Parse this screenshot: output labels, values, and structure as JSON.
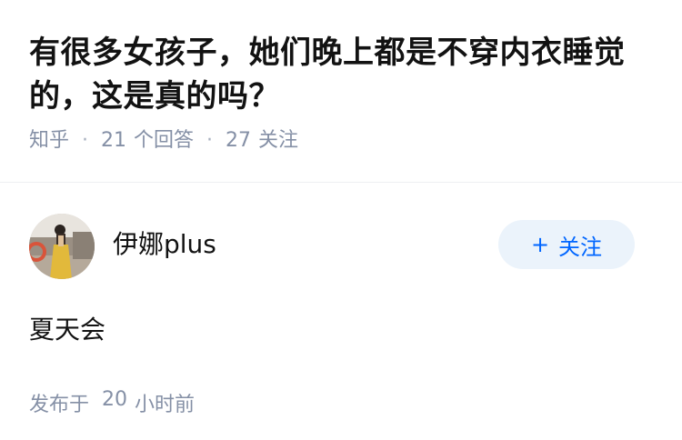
{
  "question": {
    "title": "有很多女孩子，她们晚上都是不穿内衣睡觉的，这是真的吗？",
    "source": "知乎",
    "separator": "·",
    "answer_count": "21",
    "answer_label": "个回答",
    "follow_count": "27",
    "follow_label": "关注"
  },
  "answer": {
    "author": {
      "name": "伊娜plus",
      "avatar_icon": "avatar-photo"
    },
    "follow_button": {
      "icon": "+",
      "label": "关注"
    },
    "content": "夏天会",
    "time": {
      "prefix": "发布于",
      "value": "20",
      "unit": "小时前"
    }
  },
  "colors": {
    "text": "#121212",
    "meta": "#8590a6",
    "accent": "#0066ff",
    "button_bg": "#ebf3fb"
  }
}
